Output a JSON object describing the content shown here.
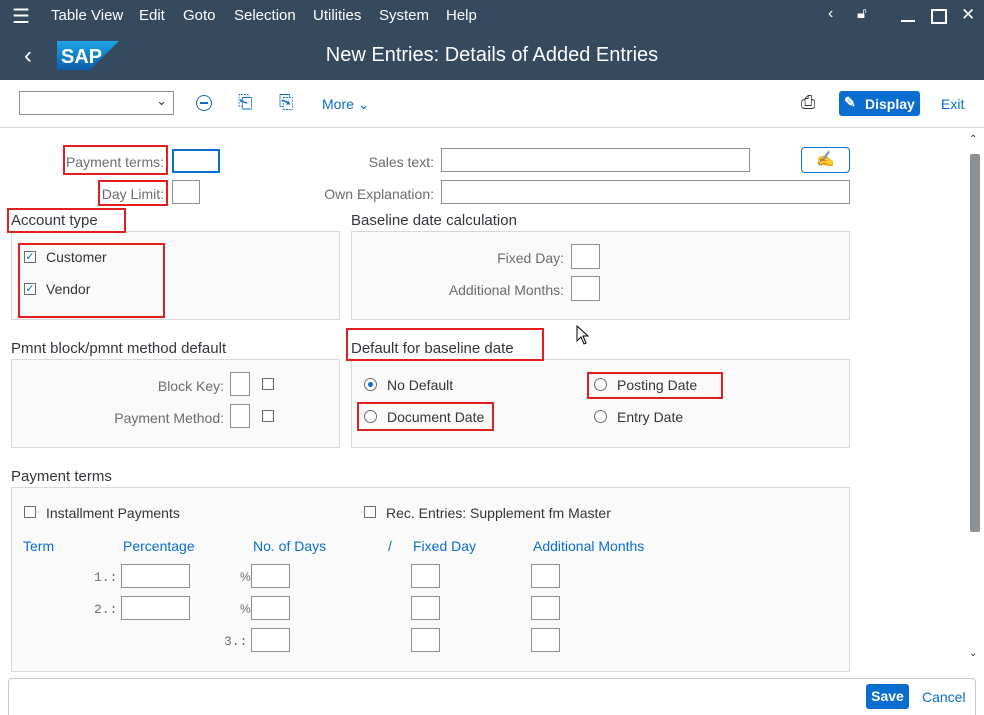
{
  "menu": {
    "items": [
      "Table View",
      "Edit",
      "Goto",
      "Selection",
      "Utilities",
      "System",
      "Help"
    ]
  },
  "header": {
    "title": "New Entries: Details of Added Entries",
    "logo": "SAP"
  },
  "toolbar": {
    "more_label": "More",
    "display_label": "Display",
    "exit_label": "Exit"
  },
  "form": {
    "payment_terms_label": "Payment terms:",
    "payment_terms_value": "",
    "day_limit_label": "Day Limit:",
    "sales_text_label": "Sales text:",
    "own_explanation_label": "Own Explanation:",
    "account_type_title": "Account type",
    "customer_label": "Customer",
    "vendor_label": "Vendor",
    "customer_checked": true,
    "vendor_checked": true,
    "baseline_title": "Baseline date calculation",
    "fixed_day_label": "Fixed Day:",
    "additional_months_label": "Additional Months:",
    "pmnt_block_title": "Pmnt block/pmnt method default",
    "block_key_label": "Block Key:",
    "payment_method_label": "Payment Method:",
    "default_baseline_title": "Default for baseline date",
    "no_default_label": "No Default",
    "posting_date_label": "Posting Date",
    "document_date_label": "Document Date",
    "entry_date_label": "Entry Date",
    "payment_terms_section_title": "Payment terms",
    "installment_label": "Installment Payments",
    "rec_entries_label": "Rec. Entries: Supplement fm Master",
    "table_headers": {
      "term": "Term",
      "percentage": "Percentage",
      "no_of_days": "No. of Days",
      "slash": "/",
      "fixed_day": "Fixed Day",
      "additional_months": "Additional Months"
    },
    "rows": [
      "1.:",
      "2.:",
      "3.:"
    ],
    "percent_sign": "%"
  },
  "footer": {
    "save_label": "Save",
    "cancel_label": "Cancel"
  },
  "colors": {
    "shell": "#354a5f",
    "accent": "#0a6ed1",
    "highlight": "#e21f1f"
  }
}
